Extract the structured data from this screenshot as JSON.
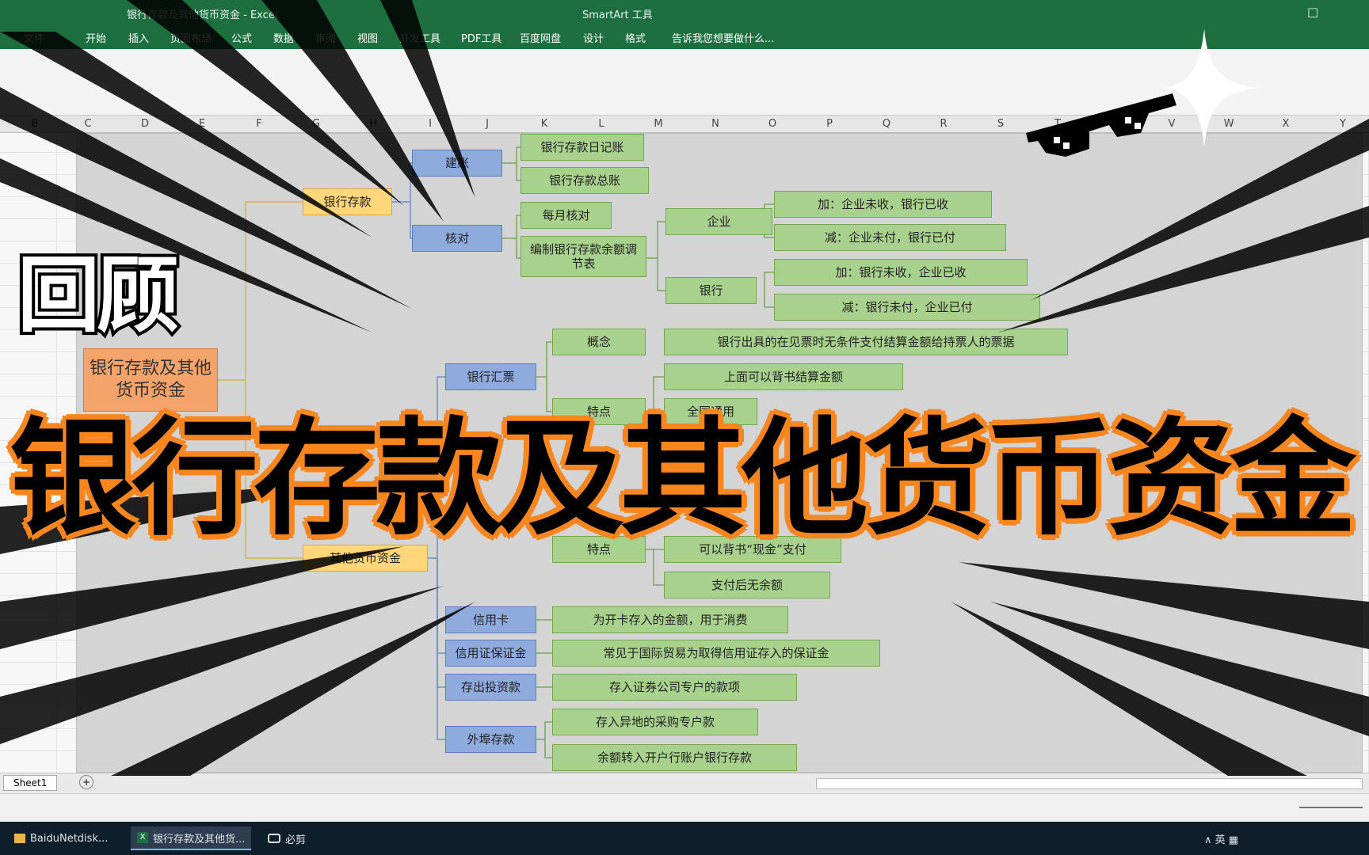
{
  "window": {
    "title": "银行存款及其他货币资金 - Excel",
    "contextual_tool": "SmartArt 工具",
    "window_button": "□"
  },
  "ribbon_tabs": [
    "文件",
    "开始",
    "插入",
    "页面布局",
    "公式",
    "数据",
    "审阅",
    "视图",
    "开发工具",
    "PDF工具",
    "百度网盘",
    "设计",
    "格式",
    "告诉我您想要做什么..."
  ],
  "column_letters": [
    "B",
    "C",
    "D",
    "E",
    "F",
    "G",
    "H",
    "I",
    "J",
    "K",
    "L",
    "M",
    "N",
    "O",
    "P",
    "Q",
    "R",
    "S",
    "T",
    "U",
    "V",
    "W",
    "X",
    "Y"
  ],
  "mindmap": {
    "root": "银行存款及其他货币资金",
    "branch_bank_deposit": "银行存款",
    "branch_other_funds": "其他货币资金",
    "account_setup": "建账",
    "journal": "银行存款日记账",
    "ledger": "银行存款总账",
    "reconcile": "核对",
    "monthly_check": "每月核对",
    "reconciliation_stmt": "编制银行存款余额调节表",
    "enterprise": "企业",
    "ent_add": "加：企业未收，银行已收",
    "ent_sub": "减：企业未付，银行已付",
    "bank": "银行",
    "bank_add": "加：银行未收，企业已收",
    "bank_sub": "减：银行未付，企业已付",
    "bank_draft": "银行汇票",
    "concept": "概念",
    "draft_concept_text": "银行出具的在见票时无条件支付结算金额给持票人的票据",
    "features": "特点",
    "draft_feature_1": "上面可以背书结算金额",
    "draft_feature_2": "全国通用",
    "features_2": "特点",
    "feature_cash": "可以背书“现金”支付",
    "feature_no_balance": "支付后无余额",
    "credit_card": "信用卡",
    "credit_card_text": "为开卡存入的金额，用于消费",
    "lc_deposit": "信用证保证金",
    "lc_deposit_text": "常见于国际贸易为取得信用证存入的保证金",
    "investment_deposit": "存出投资款",
    "investment_text": "存入证券公司专户的款项",
    "remote_deposit": "外埠存款",
    "remote_text_1": "存入异地的采购专户款",
    "remote_text_2": "余额转入开户行账户银行存款"
  },
  "sheet_tab": "Sheet1",
  "taskbar": {
    "items": [
      "BaiduNetdisk...",
      "银行存款及其他货...",
      "必剪"
    ],
    "tray": "∧  英  ▦"
  },
  "overlay": {
    "small_caption": "回顾",
    "big_caption": "银行存款及其他货币资金"
  },
  "colors": {
    "excel_green": "#1e6f40",
    "node_blue": "#8faadc",
    "node_orange": "#ffd77a",
    "node_green": "#a9d18e",
    "caption_orange": "#f7861e"
  }
}
